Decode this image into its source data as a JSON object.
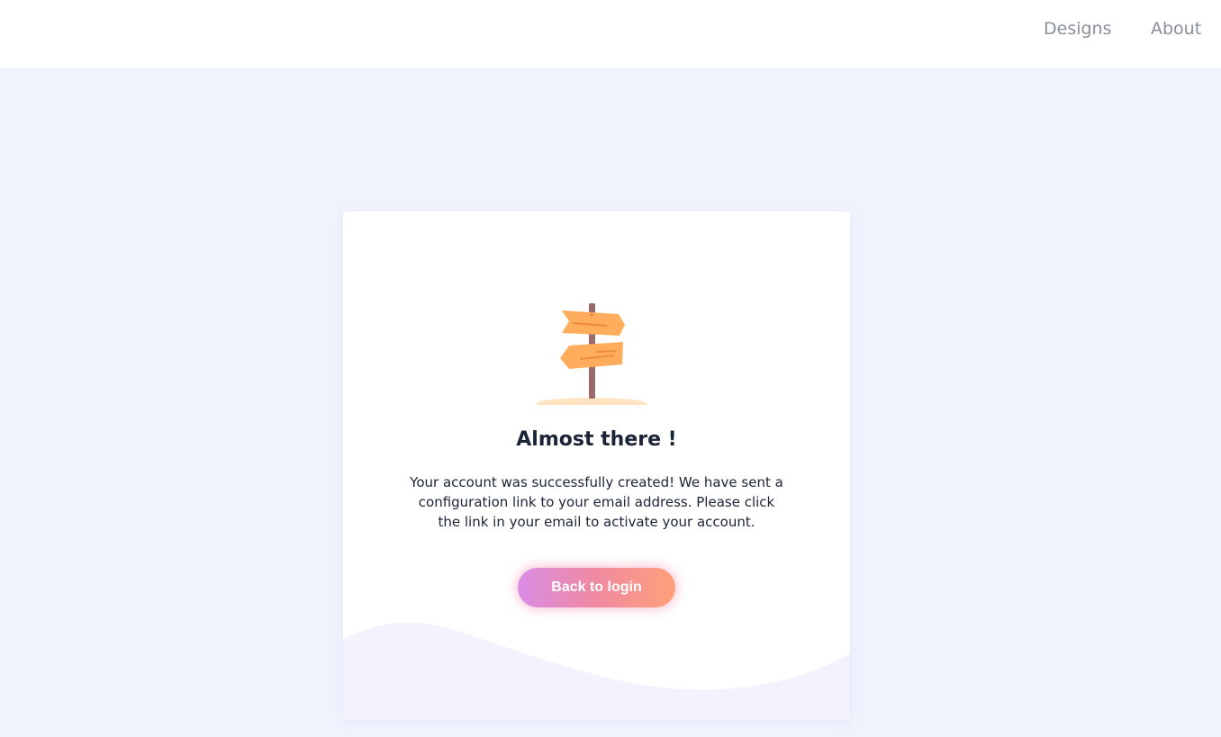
{
  "nav": {
    "links": [
      {
        "label": "Designs"
      },
      {
        "label": "About"
      }
    ]
  },
  "card": {
    "illustration_icon": "signpost-icon",
    "title": "Almost there !",
    "message": "Your account was successfully created! We have sent a configuration link to your email address. Please click the link in your email to activate your account.",
    "button_label": "Back to login"
  },
  "colors": {
    "page_background": "#f0f3fe",
    "card_background": "#ffffff",
    "text_dark": "#1b2337",
    "nav_text": "#8a8f99",
    "button_gradient_start": "#d98ce6",
    "button_gradient_end": "#ffa07a",
    "wave": "#f4f2fd"
  }
}
